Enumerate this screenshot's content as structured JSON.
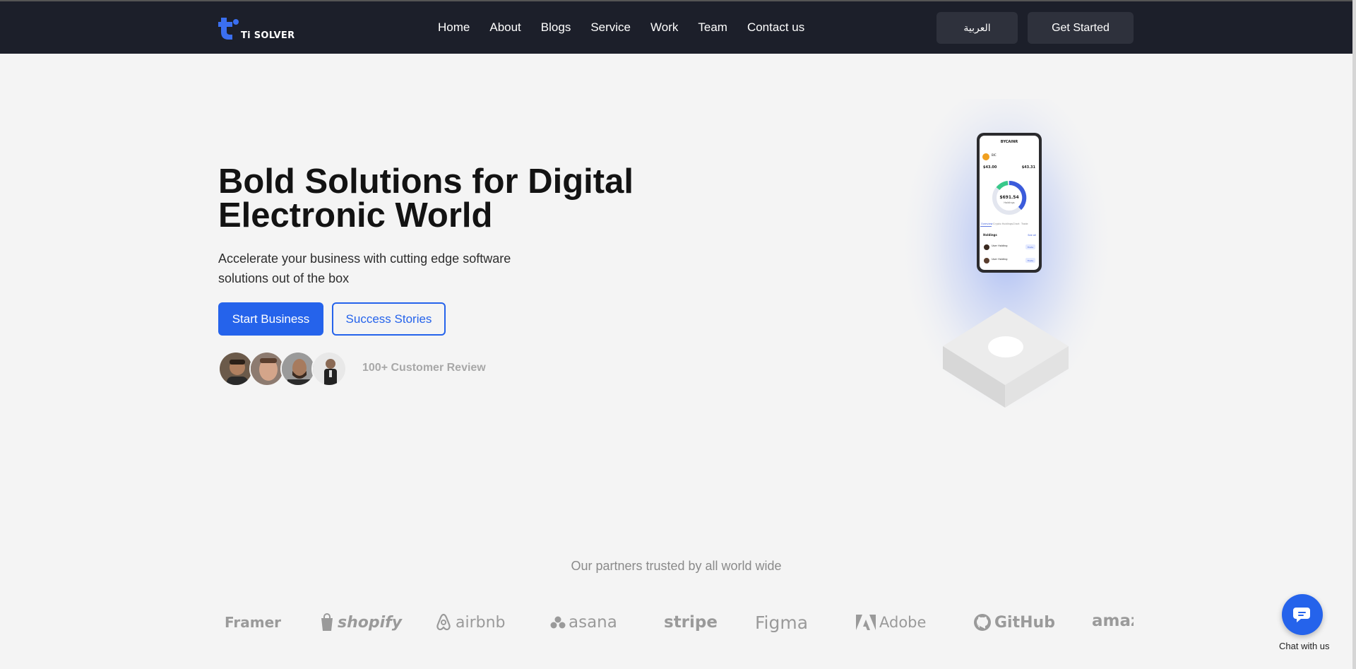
{
  "nav": {
    "logo_text": "Ti SOLVER",
    "links": [
      "Home",
      "About",
      "Blogs",
      "Service",
      "Work",
      "Team",
      "Contact us"
    ],
    "lang_label": "العربية",
    "cta_label": "Get Started"
  },
  "hero": {
    "title": "Bold Solutions for Digital Electronic World",
    "subtitle": "Accelerate your business with cutting edge software solutions out of the box",
    "primary_label": "Start Business",
    "secondary_label": "Success Stories",
    "review_text": "100+ Customer Review"
  },
  "phone": {
    "header": "BYCAINR",
    "coin": "BIC",
    "value_left": "$43.00",
    "value_right": "$43.31",
    "total": "$691.54",
    "total_label": "Holdings",
    "tabs": [
      "Overview",
      "Crypto Holdings",
      "Chart",
      "Trade"
    ],
    "section": "Holdings",
    "see_all": "See all",
    "rows": [
      "User Holding",
      "User Holding"
    ],
    "row_btn": "Trade"
  },
  "partners": {
    "title": "Our partners trusted by all world wide",
    "logos": [
      "Framer",
      "shopify",
      "airbnb",
      "asana",
      "stripe",
      "Figma",
      "Adobe",
      "GitHub",
      "amazon"
    ]
  },
  "chat": {
    "label": "Chat with us"
  },
  "colors": {
    "accent": "#2563eb",
    "nav_bg": "#1c1f2a",
    "page_bg": "#f4f4f4"
  }
}
